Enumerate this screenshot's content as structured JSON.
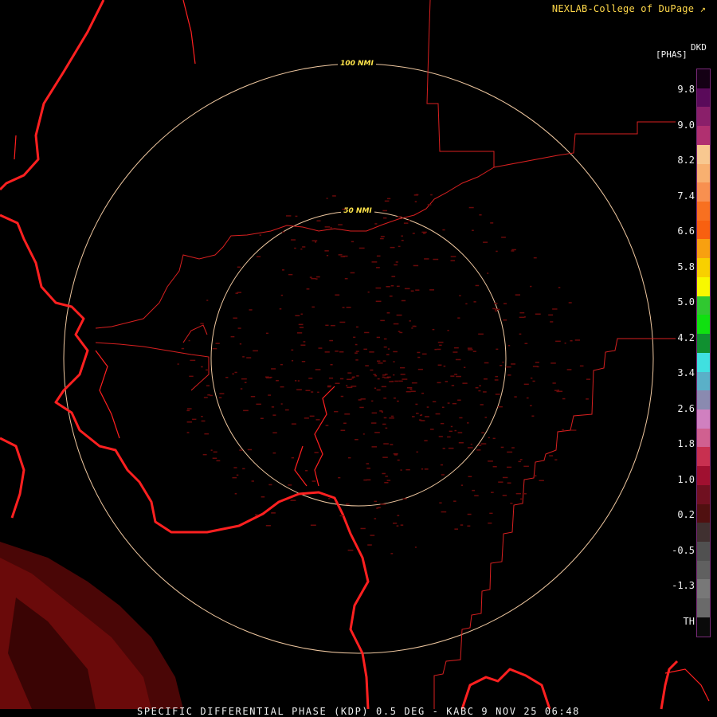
{
  "header": {
    "credit": "NEXLAB-College of DuPage",
    "credit_icon": "external-link-icon"
  },
  "legend": {
    "unit_top": "[PHAS]",
    "unit_name": "DKD",
    "labels": [
      "9.8",
      "9.0",
      "8.2",
      "7.4",
      "6.6",
      "5.8",
      "5.0",
      "4.2",
      "3.4",
      "2.6",
      "1.8",
      "1.0",
      "0.2",
      "-0.5",
      "-1.3",
      "TH"
    ],
    "colors": [
      "#140014",
      "#5a0a5a",
      "#8a1f6a",
      "#b03070",
      "#f8c890",
      "#f8b070",
      "#f89050",
      "#f87020",
      "#f86010",
      "#f8a010",
      "#f8d000",
      "#f8f800",
      "#30c830",
      "#10e010",
      "#109030",
      "#40e0e0",
      "#5ab0c8",
      "#8a8ab0",
      "#d080c0",
      "#d06090",
      "#c83050",
      "#a01030",
      "#701020",
      "#501010",
      "#403030",
      "#505050",
      "#606060",
      "#787878",
      "#6a6a6a",
      "#0a0a0a"
    ]
  },
  "map": {
    "rings": [
      "100 NMI",
      "50 NMI"
    ],
    "colors": {
      "coast": "#ff2020",
      "border": "#d82020",
      "ring": "#f0c8a0",
      "clutter": "#6a0a0a"
    }
  },
  "footer": {
    "caption": "SPECIFIC DIFFERENTIAL PHASE (KDP) 0.5 DEG - KABC 9 NOV 25 06:48"
  }
}
